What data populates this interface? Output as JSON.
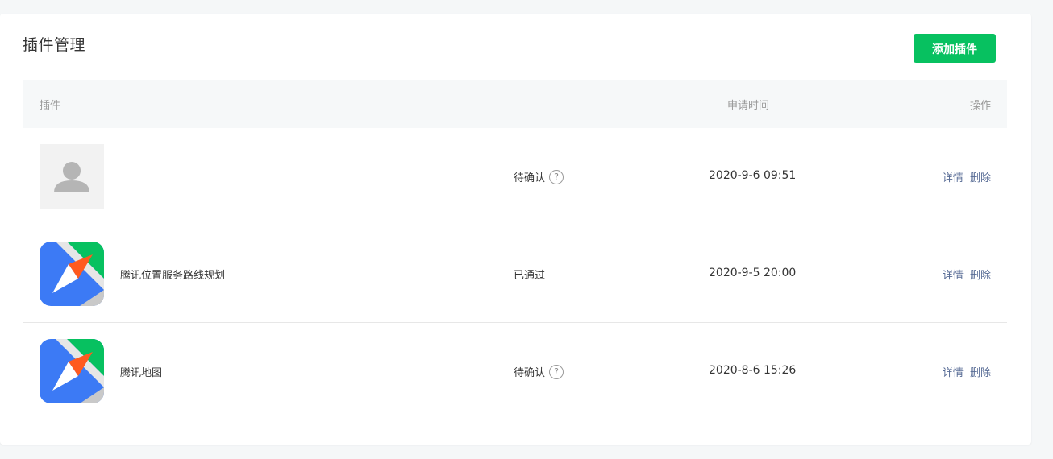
{
  "header": {
    "title": "插件管理",
    "add_button": "添加插件"
  },
  "table": {
    "columns": {
      "plugin": "插件",
      "time": "申请时间",
      "actions": "操作"
    },
    "rows": [
      {
        "icon": "default-avatar-icon",
        "name": "",
        "status": "待确认",
        "has_help": true,
        "time": "2020-9-6 09:51",
        "detail": "详情",
        "delete": "删除"
      },
      {
        "icon": "tencent-map-icon",
        "name": "腾讯位置服务路线规划",
        "status": "已通过",
        "has_help": false,
        "time": "2020-9-5 20:00",
        "detail": "详情",
        "delete": "删除"
      },
      {
        "icon": "tencent-map-icon",
        "name": "腾讯地图",
        "status": "待确认",
        "has_help": true,
        "time": "2020-8-6 15:26",
        "detail": "详情",
        "delete": "删除"
      }
    ]
  },
  "help_glyph": "?",
  "colors": {
    "accent": "#07c160",
    "link": "#576b95",
    "header_bg": "#f6f8f9"
  }
}
